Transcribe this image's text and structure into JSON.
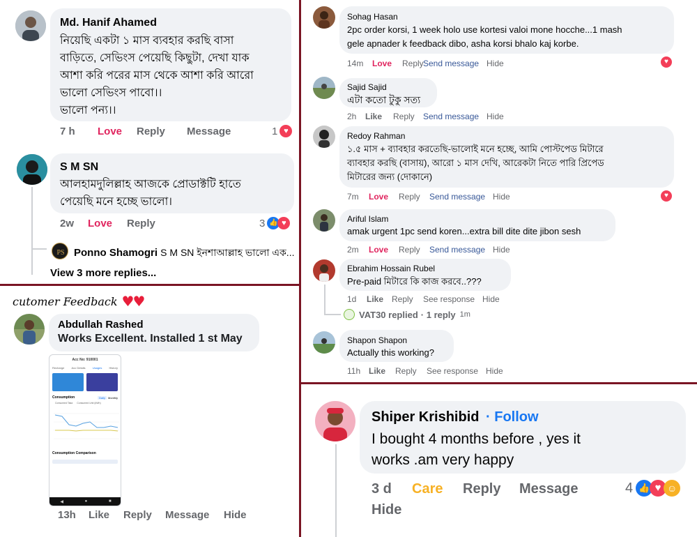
{
  "tl": {
    "c1": {
      "name": "Md. Hanif Ahamed",
      "text": "নিয়েছি একটা ১ মাস ব্যবহার করছি বাসা\nবাড়িতে, সেভিংস পেয়েছি কিছুটা, দেখা যাক\nআশা করি পরের মাস থেকে আশা করি আরো\nভালো সেভিংস পাবো।।\nভালো পন্য।।",
      "time": "7 h",
      "love": "Love",
      "reply": "Reply",
      "message": "Message",
      "count": "1"
    },
    "c2": {
      "name": "S M SN",
      "text": "আলহামদুলিল্লাহ আজকে প্রোডাক্টটি  হাতে\nপেয়েছি মনে হচ্ছে ভালো।",
      "time": "2w",
      "love": "Love",
      "reply": "Reply",
      "count": "3"
    },
    "reply": {
      "name": "Ponno Shamogri",
      "text": "S M SN ইনশাআল্লাহ ভালো এক..."
    },
    "more": "View 3 more replies..."
  },
  "bl": {
    "header": "cutomer Feedback",
    "c1": {
      "name": "Abdullah Rashed",
      "text": "Works Excellent. Installed 1 st May",
      "time": "13h",
      "like": "Like",
      "reply": "Reply",
      "message": "Message",
      "hide": "Hide"
    },
    "phone": {
      "title": "Acc No: 910001",
      "tabs": [
        "Recharge",
        "Acc Details",
        "Usages",
        "History"
      ],
      "section": "Consumption",
      "daily": "Daily",
      "monthly": "Monthly",
      "legend1": "Consumed Taka",
      "legend2": "Consumed Unit (kWh)",
      "comparison": "Consumption Comparison"
    }
  },
  "r": {
    "c1": {
      "name": "Sohag Hasan",
      "text": "2pc order korsi, 1 week holo use kortesi valoi mone hocche...1 mash\ngele apnader k feedback dibo, asha korsi bhalo kaj korbe.",
      "time": "14m",
      "love": "Love",
      "reply": "Reply",
      "send": "Send message",
      "hide": "Hide"
    },
    "c2": {
      "name": "Sajid Sajid",
      "text": "এটা কতো টুকু সত্য",
      "time": "2h",
      "like": "Like",
      "reply": "Reply",
      "send": "Send message",
      "hide": "Hide"
    },
    "c3": {
      "name": "Redoy Rahman",
      "text": "১.৫ মাস + ব্যাবহার করতেছি-ভালোই মনে হচ্ছে, আমি পোস্টপেড মিটারে\nব্যাবহার করছি (বাসায়), আরো ১ মাস দেখি, আরেকটা নিতে পারি প্রিপেড\nমিটারের জন্য (দোকানে)",
      "time": "7m",
      "love": "Love",
      "reply": "Reply",
      "send": "Send message",
      "hide": "Hide"
    },
    "c4": {
      "name": "Ariful Islam",
      "text": "amak urgent 1pc send koren...extra bill dite dite jibon sesh",
      "time": "2m",
      "love": "Love",
      "reply": "Reply",
      "send": "Send message",
      "hide": "Hide"
    },
    "c5": {
      "name": "Ebrahim Hossain Rubel",
      "text": "Pre-paid মিটারে কি কাজ করবে..???",
      "time": "1d",
      "like": "Like",
      "reply": "Reply",
      "see": "See response",
      "hide": "Hide"
    },
    "replied": {
      "name": "VAT30 replied",
      "count": "· 1 reply",
      "time": "1m",
      "badge": "VAT30"
    },
    "c6": {
      "name": "Shapon Shapon",
      "text": "Actually this working?",
      "time": "11h",
      "like": "Like",
      "reply": "Reply",
      "see": "See response",
      "hide": "Hide"
    }
  },
  "br": {
    "c1": {
      "name": "Shiper Krishibid",
      "follow": "· Follow",
      "text": "I bought 4 months before , yes it\nworks .am very happy",
      "time": "3 d",
      "care": "Care",
      "reply": "Reply",
      "message": "Message",
      "hide": "Hide",
      "count": "4"
    }
  },
  "colors": {
    "divider": "#7a1524",
    "bubble": "#f0f2f5",
    "love": "#e0245e",
    "link": "#385898",
    "care": "#f7b125"
  }
}
